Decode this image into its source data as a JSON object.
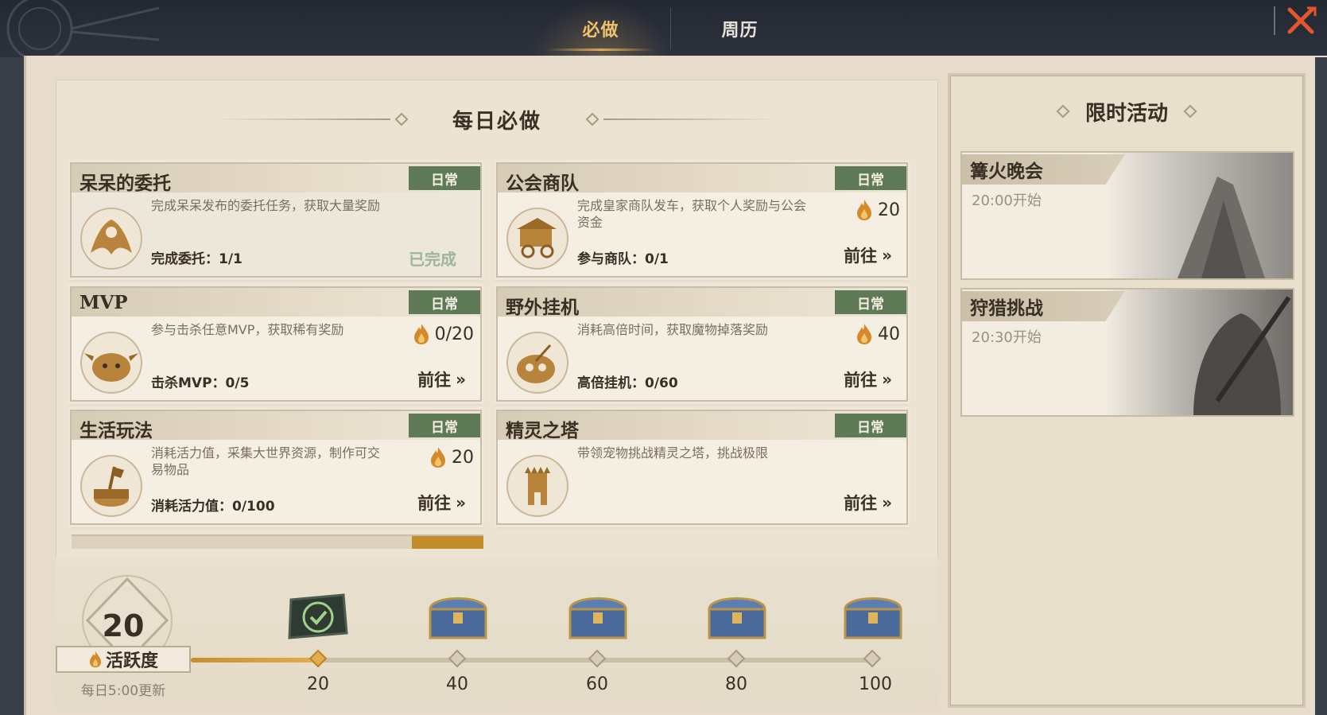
{
  "tabs": {
    "must_do": "必做",
    "weekly_calendar": "周历"
  },
  "section_title": "每日必做",
  "tasks": [
    {
      "title": "呆呆的委托",
      "badge": "日常",
      "description": "完成呆呆发布的委托任务，获取大量奖励",
      "progress": "完成委托：1/1",
      "reward": "",
      "action": "已完成",
      "icon": "winged-figure-icon",
      "completed": true
    },
    {
      "title": "公会商队",
      "badge": "日常",
      "description": "完成皇家商队发车，获取个人奖励与公会资金",
      "progress": "参与商队：0/1",
      "reward": "20",
      "action": "前往",
      "icon": "caravan-cart-icon",
      "completed": false
    },
    {
      "title": "MVP",
      "badge": "日常",
      "description": "参与击杀任意MVP，获取稀有奖励",
      "progress": "击杀MVP：0/5",
      "reward": "0/20",
      "action": "前往",
      "icon": "mvp-monster-icon",
      "completed": false
    },
    {
      "title": "野外挂机",
      "badge": "日常",
      "description": "消耗高倍时间，获取魔物掉落奖励",
      "progress": "高倍挂机：0/60",
      "reward": "40",
      "action": "前往",
      "icon": "field-afk-icon",
      "completed": false
    },
    {
      "title": "生活玩法",
      "badge": "日常",
      "description": "消耗活力值，采集大世界资源，制作可交易物品",
      "progress": "消耗活力值：0/100",
      "reward": "20",
      "action": "前往",
      "icon": "axe-stump-icon",
      "completed": false
    },
    {
      "title": "精灵之塔",
      "badge": "日常",
      "description": "带领宠物挑战精灵之塔，挑战极限",
      "progress": "",
      "reward": "",
      "action": "前往",
      "icon": "spirit-tower-icon",
      "completed": false
    }
  ],
  "activity": {
    "value": "20",
    "label": "活跃度",
    "refresh_note": "每日5:00更新",
    "progress_fraction": 0.18
  },
  "milestones": [
    {
      "label": "20",
      "claimed": true
    },
    {
      "label": "40",
      "claimed": false
    },
    {
      "label": "60",
      "claimed": false
    },
    {
      "label": "80",
      "claimed": false
    },
    {
      "label": "100",
      "claimed": false
    }
  ],
  "limited": {
    "title": "限时活动",
    "events": [
      {
        "name": "篝火晚会",
        "time": "20:00开始"
      },
      {
        "name": "狩猎挑战",
        "time": "20:30开始"
      }
    ]
  },
  "colors": {
    "accent_gold": "#f0c06a",
    "badge_green": "#5e7a56",
    "done_green": "#9fb59a",
    "parchment": "#f4eee3",
    "topbar": "#2a2f3a"
  }
}
